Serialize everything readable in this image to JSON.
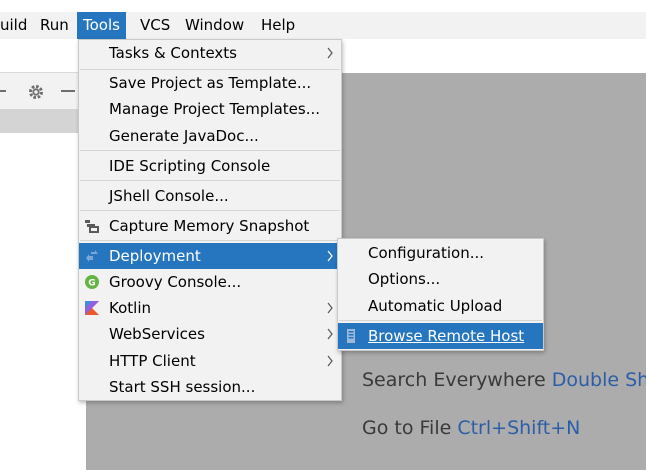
{
  "menubar": {
    "items": [
      {
        "label": "uild"
      },
      {
        "label": "Run"
      },
      {
        "label": "Tools"
      },
      {
        "label": "VCS"
      },
      {
        "label": "Window"
      },
      {
        "label": "Help"
      }
    ]
  },
  "tools_menu": {
    "items": [
      {
        "label": "Tasks & Contexts",
        "submenu": true
      },
      {
        "label": "Save Project as Template..."
      },
      {
        "label": "Manage Project Templates..."
      },
      {
        "label": "Generate JavaDoc..."
      },
      {
        "label": "IDE Scripting Console"
      },
      {
        "label": "JShell Console..."
      },
      {
        "label": "Capture Memory Snapshot",
        "icon": "memory-snapshot-icon"
      },
      {
        "label": "Deployment",
        "submenu": true,
        "icon": "deployment-icon",
        "selected": true
      },
      {
        "label": "Groovy Console...",
        "icon": "groovy-icon"
      },
      {
        "label": "Kotlin",
        "submenu": true,
        "icon": "kotlin-icon"
      },
      {
        "label": "WebServices",
        "submenu": true
      },
      {
        "label": "HTTP Client",
        "submenu": true
      },
      {
        "label": "Start SSH session..."
      }
    ]
  },
  "deployment_menu": {
    "items": [
      {
        "label": "Configuration..."
      },
      {
        "label": "Options..."
      },
      {
        "label": "Automatic Upload"
      },
      {
        "label": "Browse Remote Host",
        "icon": "remote-host-icon",
        "selected": true
      }
    ]
  },
  "editor_hints": {
    "search_label": "Search Everywhere",
    "search_shortcut": "Double Sh",
    "goto_label": "Go to File",
    "goto_shortcut": "Ctrl+Shift+N"
  },
  "colors": {
    "menu_bg": "#f2f2f2",
    "selection": "#2675bf",
    "editor_bg": "#acacac",
    "shortcut": "#2c5ea8"
  }
}
